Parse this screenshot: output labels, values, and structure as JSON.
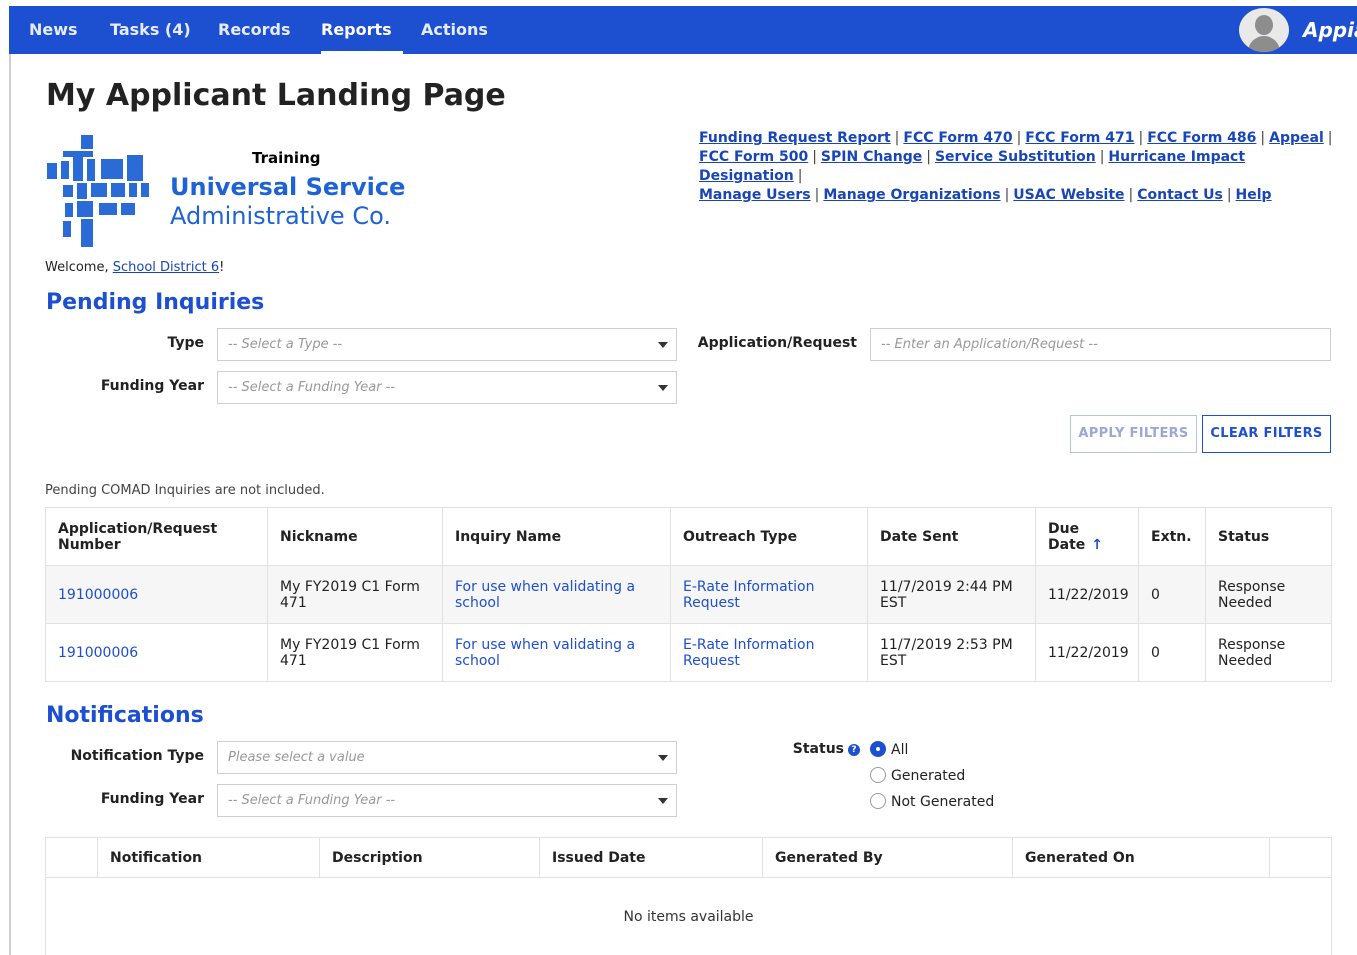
{
  "nav": {
    "items": [
      "News",
      "Tasks (4)",
      "Records",
      "Reports",
      "Actions"
    ],
    "active": "Reports",
    "brand": "Appian"
  },
  "page": {
    "title": "My Applicant Landing Page",
    "logo": {
      "training": "Training",
      "name_line1": "Universal Service",
      "name_line2": "Administrative Co."
    },
    "quick_links": [
      "Funding Request Report",
      "FCC Form 470",
      "FCC Form 471",
      "FCC Form 486",
      "Appeal",
      "FCC Form 500",
      "SPIN Change",
      "Service Substitution",
      "Hurricane Impact Designation",
      "Manage Users",
      "Manage Organizations",
      "USAC Website",
      "Contact Us",
      "Help"
    ],
    "welcome_prefix": "Welcome, ",
    "welcome_name": "School District 6",
    "welcome_suffix": "!"
  },
  "pending": {
    "title": "Pending Inquiries",
    "type_label": "Type",
    "type_placeholder": "-- Select a Type --",
    "funding_year_label": "Funding Year",
    "funding_year_placeholder": "-- Select a Funding Year --",
    "app_request_label": "Application/Request",
    "app_request_placeholder": "-- Enter an Application/Request --",
    "apply_filters": "APPLY FILTERS",
    "clear_filters": "CLEAR FILTERS",
    "note": "Pending COMAD Inquiries are not included.",
    "columns": [
      "Application/Request Number",
      "Nickname",
      "Inquiry Name",
      "Outreach Type",
      "Date Sent",
      "Due Date",
      "Extn.",
      "Status"
    ],
    "sort_indicator": "↑",
    "rows": [
      {
        "number": "191000006",
        "nickname": "My FY2019 C1 Form 471",
        "inquiry": "For use when validating a school",
        "outreach": "E-Rate Information Request",
        "date_sent": "11/7/2019 2:44 PM EST",
        "due_date": "11/22/2019",
        "extn": "0",
        "status": "Response Needed"
      },
      {
        "number": "191000006",
        "nickname": "My FY2019 C1 Form 471",
        "inquiry": "For use when validating a school",
        "outreach": "E-Rate Information Request",
        "date_sent": "11/7/2019 2:53 PM EST",
        "due_date": "11/22/2019",
        "extn": "0",
        "status": "Response Needed"
      }
    ]
  },
  "notifications": {
    "title": "Notifications",
    "type_label": "Notification Type",
    "type_placeholder": "Please select a value",
    "funding_year_label": "Funding Year",
    "funding_year_placeholder": "-- Select a Funding Year --",
    "status_label": "Status",
    "status_options": [
      "All",
      "Generated",
      "Not Generated"
    ],
    "status_selected": "All",
    "columns": [
      "Notification",
      "Description",
      "Issued Date",
      "Generated By",
      "Generated On"
    ],
    "empty_text": "No items available"
  },
  "colors": {
    "nav_bg": "#1d4fd1",
    "accent": "#1d4fd1",
    "link": "#1846b8"
  }
}
